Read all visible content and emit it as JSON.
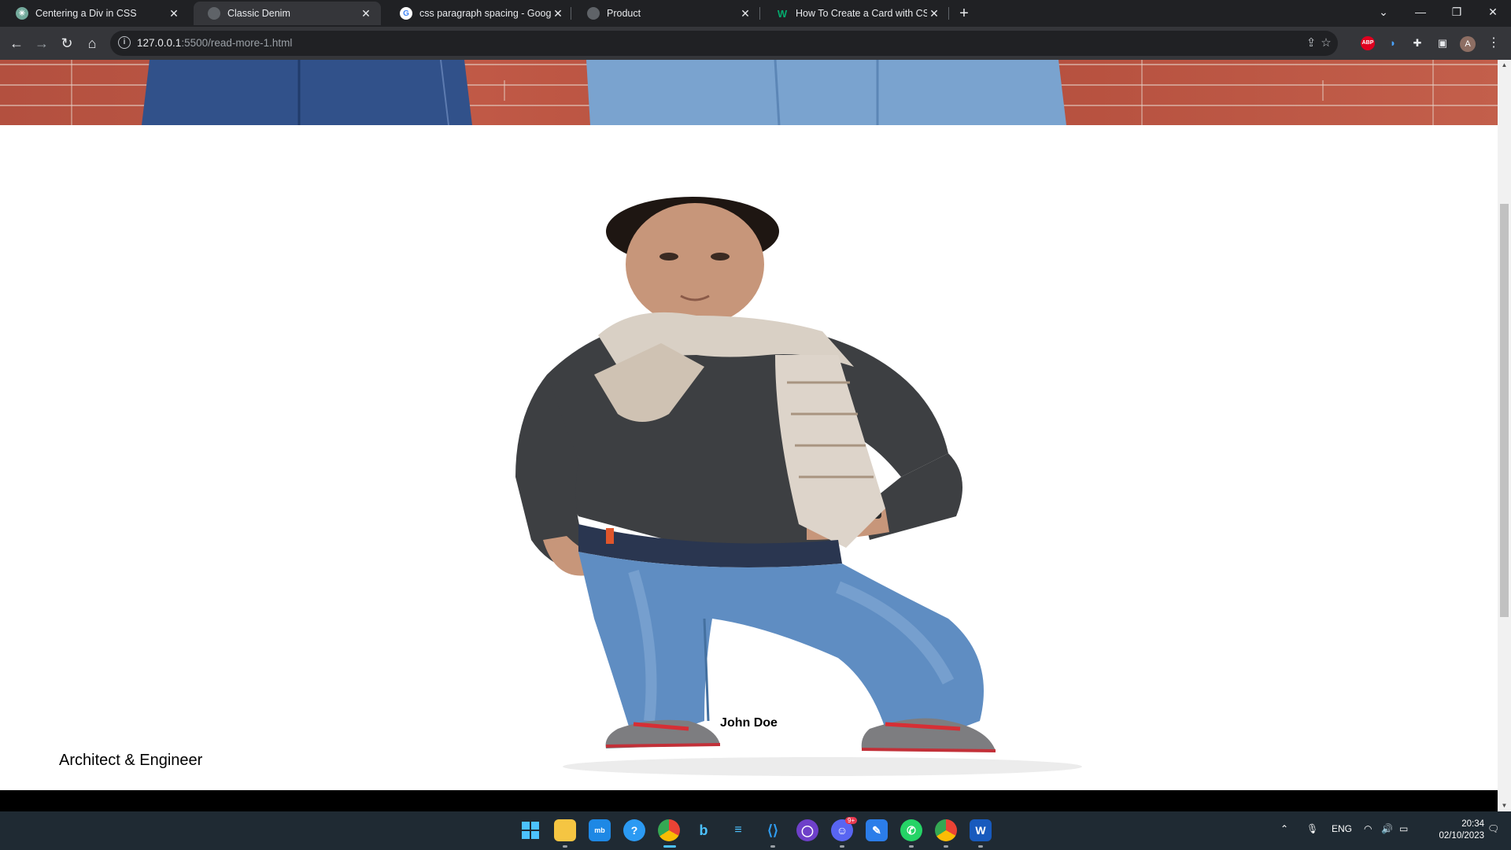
{
  "browser": {
    "tabs": [
      {
        "title": "Centering a Div in CSS",
        "favicon": "chatgpt-icon",
        "active": false
      },
      {
        "title": "Classic Denim",
        "favicon": "globe-icon",
        "active": true
      },
      {
        "title": "css paragraph spacing - Google",
        "favicon": "google-icon",
        "active": false
      },
      {
        "title": "Product",
        "favicon": "globe-icon",
        "active": false
      },
      {
        "title": "How To Create a Card with CSS",
        "favicon": "w3schools-icon",
        "active": false
      }
    ],
    "new_tab_label": "+",
    "address": {
      "host": "127.0.0.1",
      "path": ":5500/read-more-1.html"
    },
    "profile_initial": "A",
    "extensions": [
      "share-icon",
      "star-icon",
      "adblock-plus-icon",
      "voice-icon",
      "puzzle-icon",
      "side-panel-icon"
    ],
    "adblock_label": "ABP"
  },
  "page": {
    "product_name": "John Doe",
    "product_subtitle": "Architect & Engineer"
  },
  "taskbar": {
    "apps": [
      "windows-start-icon",
      "file-explorer-icon",
      "mobaxterm-icon",
      "help-icon",
      "chrome-icon",
      "bing-icon",
      "azure-data-studio-icon",
      "vscode-icon",
      "github-icon",
      "discord-icon",
      "snipping-tool-icon",
      "whatsapp-icon",
      "chrome-profile-icon",
      "word-icon"
    ],
    "discord_badge": "9+",
    "language": "ENG",
    "time": "20:34",
    "date": "02/10/2023"
  },
  "colors": {
    "tabstrip": "#202124",
    "toolbar": "#35363a",
    "brick": "#b9513f",
    "taskbar": "#1f2a33",
    "footer": "#000000"
  }
}
